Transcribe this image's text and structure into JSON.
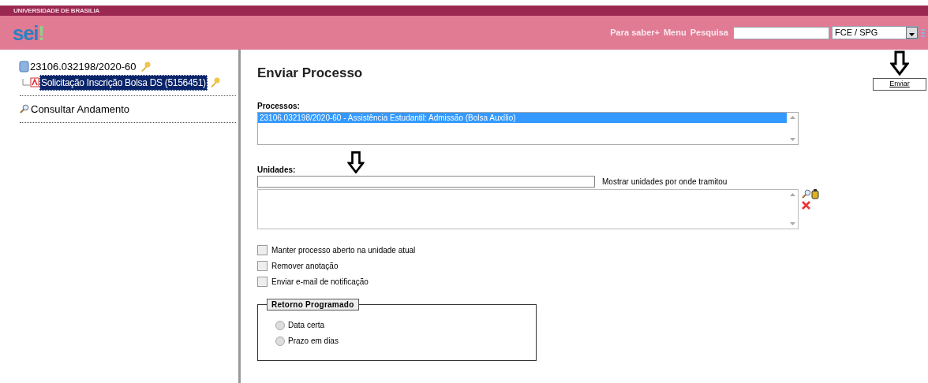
{
  "header": {
    "org": "UNIVERSIDADE DE BRASILIA",
    "logo": "sei",
    "logo_mark": "!",
    "links": [
      "Para saber+",
      "Menu",
      "Pesquisa"
    ],
    "unit": "FCE / SPG"
  },
  "tree": {
    "process": "23106.032198/2020-60",
    "document": {
      "label": "Solicitação Inscrição Bolsa DS (5156451)",
      "selected": true
    }
  },
  "sidebar": {
    "items": [
      "Consultar Andamento"
    ]
  },
  "page": {
    "title": "Enviar Processo",
    "send_button": "Enviar",
    "processes": {
      "label": "Processos:",
      "items": [
        {
          "label": "23106.032198/2020-60 - Assistência Estudantil: Admissão (Bolsa Auxílio)",
          "selected": true
        }
      ]
    },
    "units": {
      "label": "Unidades:",
      "link": "Mostrar unidades por onde tramitou"
    },
    "options": [
      {
        "label": "Manter processo aberto na unidade atual",
        "checked": false
      },
      {
        "label": "Remover anotação",
        "checked": false
      },
      {
        "label": "Enviar e-mail de notificação",
        "checked": false
      }
    ],
    "return": {
      "legend": "Retorno Programado",
      "choices": [
        {
          "label": "Data certa",
          "selected": false
        },
        {
          "label": "Prazo em dias",
          "selected": false
        }
      ]
    }
  }
}
